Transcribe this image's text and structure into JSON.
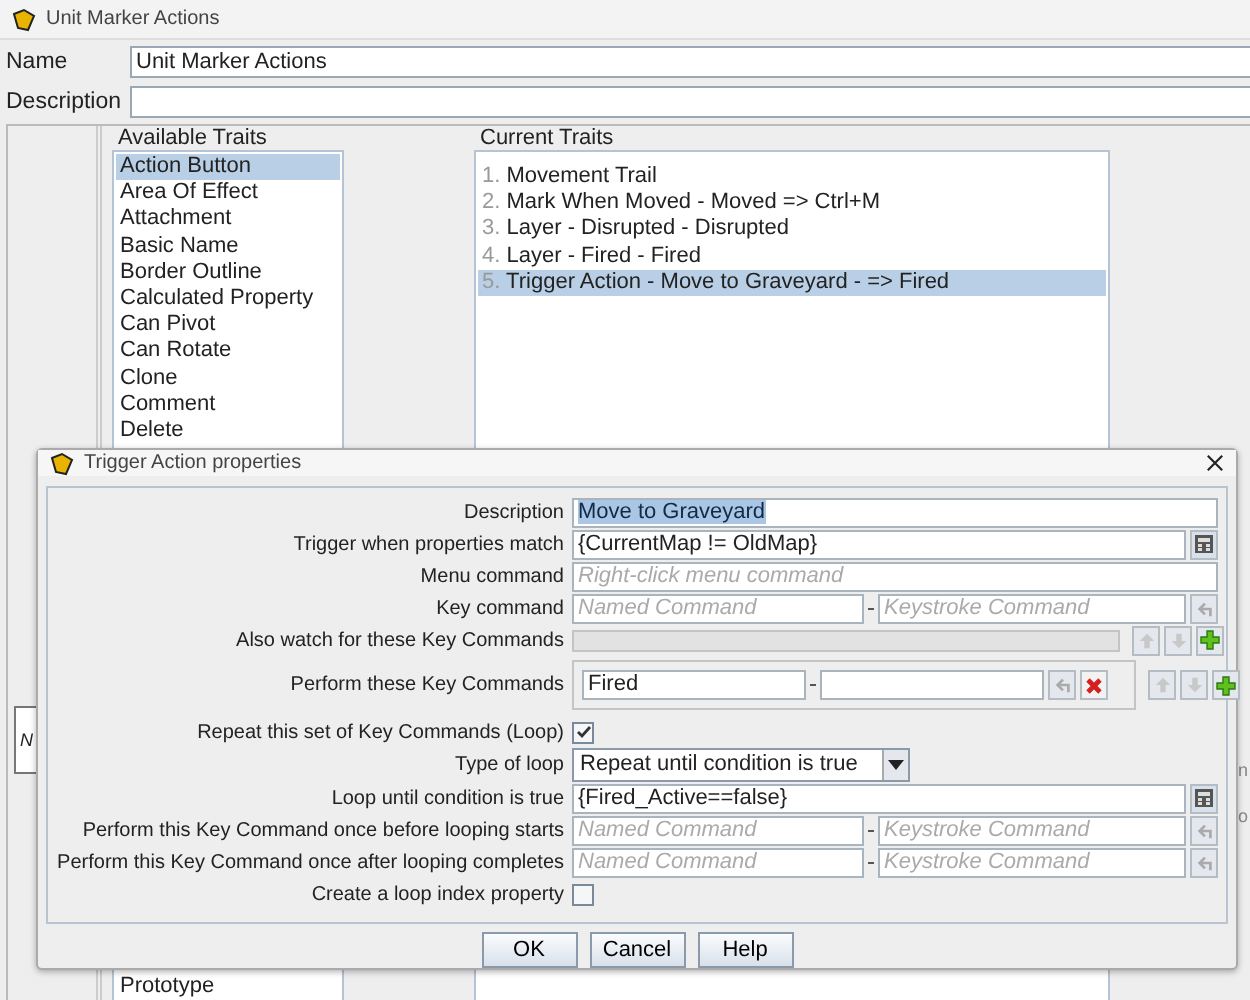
{
  "window": {
    "title": "Unit Marker Actions",
    "name_label": "Name",
    "name_value": "Unit Marker Actions",
    "description_label": "Description"
  },
  "available_traits": {
    "title": "Available Traits",
    "items": [
      {
        "label": "Action Button",
        "selected": true
      },
      {
        "label": "Area Of Effect",
        "selected": false
      },
      {
        "label": "Attachment",
        "selected": false
      },
      {
        "label": "Basic Name",
        "selected": false
      },
      {
        "label": "Border Outline",
        "selected": false
      },
      {
        "label": "Calculated Property",
        "selected": false
      },
      {
        "label": "Can Pivot",
        "selected": false
      },
      {
        "label": "Can Rotate",
        "selected": false
      },
      {
        "label": "Clone",
        "selected": false
      },
      {
        "label": "Comment",
        "selected": false
      },
      {
        "label": "Delete",
        "selected": false
      }
    ],
    "last_visible": "Prototype"
  },
  "current_traits": {
    "title": "Current Traits",
    "items": [
      {
        "index": "1.",
        "label": "Movement Trail",
        "selected": false
      },
      {
        "index": "2.",
        "label": "Mark When Moved - Moved => Ctrl+M",
        "selected": false
      },
      {
        "index": "3.",
        "label": "Layer - Disrupted - Disrupted",
        "selected": false
      },
      {
        "index": "4.",
        "label": "Layer - Fired - Fired",
        "selected": false
      },
      {
        "index": "5.",
        "label": "Trigger Action - Move to Graveyard - => Fired",
        "selected": true
      }
    ]
  },
  "clipped_texts": {
    "left": "N",
    "right_1": "n",
    "right_2": "o"
  },
  "dialog": {
    "title": "Trigger Action properties",
    "rows": [
      {
        "kind": "text",
        "label": "Description",
        "value": "Move to Graveyard",
        "highlighted": true
      },
      {
        "kind": "expression",
        "label": "Trigger when properties match",
        "value": "{CurrentMap != OldMap}"
      },
      {
        "kind": "text",
        "label": "Menu command",
        "placeholder": "Right-click menu command"
      },
      {
        "kind": "key",
        "label": "Key command",
        "name_placeholder": "Named Command",
        "keystroke_placeholder": "Keystroke Command"
      },
      {
        "kind": "key_list",
        "label": "Also watch for these Key Commands",
        "entries": []
      },
      {
        "kind": "key_list",
        "label": "Perform these Key Commands",
        "entries": [
          {
            "name": "Fired"
          }
        ]
      },
      {
        "kind": "checkbox",
        "label": "Repeat this set of Key Commands (Loop)",
        "checked": true
      },
      {
        "kind": "dropdown",
        "label": "Type of loop",
        "value": "Repeat until condition is true"
      },
      {
        "kind": "expression",
        "label": "Loop until condition is true",
        "value": "{Fired_Active==false}"
      },
      {
        "kind": "key",
        "label": "Perform this Key Command once before looping starts",
        "name_placeholder": "Named Command",
        "keystroke_placeholder": "Keystroke Command"
      },
      {
        "kind": "key",
        "label": "Perform this Key Command once after looping completes",
        "name_placeholder": "Named Command",
        "keystroke_placeholder": "Keystroke Command"
      },
      {
        "kind": "checkbox",
        "label": "Create a loop index property",
        "checked": false
      }
    ],
    "buttons": [
      "OK",
      "Cancel",
      "Help"
    ]
  }
}
